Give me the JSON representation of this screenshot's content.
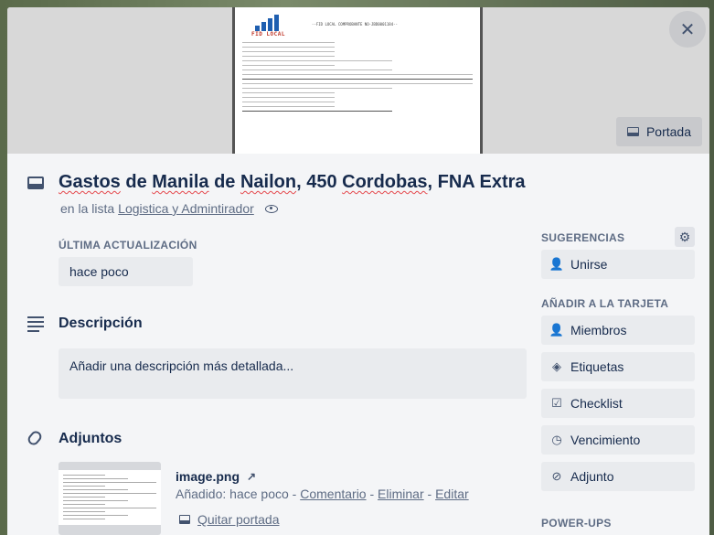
{
  "cover": {
    "button_label": "Portada",
    "doc_logo_text": "FID LOCAL",
    "doc_header": "--FID LOCAL COMPROBANTE NO-JBD0001184--"
  },
  "card": {
    "title_words": [
      "Gastos",
      " de ",
      "Manila",
      " de ",
      "Nailon",
      ", 450 ",
      "Cordobas",
      ", FNA Extra"
    ],
    "list_prefix": "en la lista",
    "list_name": "Logistica y Admintirador"
  },
  "last_update": {
    "label": "ÚLTIMA ACTUALIZACIÓN",
    "value": "hace poco"
  },
  "description": {
    "title": "Descripción",
    "placeholder": "Añadir una descripción más detallada..."
  },
  "attachments": {
    "title": "Adjuntos",
    "file_name": "image.png",
    "added_prefix": "Añadido: hace poco",
    "sep": " - ",
    "comment_link": "Comentario",
    "delete_link": "Eliminar",
    "edit_link": "Editar",
    "remove_cover_link": "Quitar portada"
  },
  "sidebar": {
    "suggestions_label": "SUGERENCIAS",
    "join_label": "Unirse",
    "add_to_card_label": "AÑADIR A LA TARJETA",
    "items": [
      {
        "label": "Miembros",
        "icon": "person-icon"
      },
      {
        "label": "Etiquetas",
        "icon": "tag-icon"
      },
      {
        "label": "Checklist",
        "icon": "checklist-icon"
      },
      {
        "label": "Vencimiento",
        "icon": "clock-icon"
      },
      {
        "label": "Adjunto",
        "icon": "paperclip-icon"
      }
    ],
    "powerups_label": "POWER-UPS"
  }
}
